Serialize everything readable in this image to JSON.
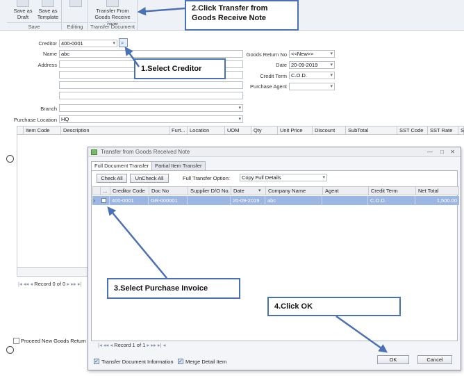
{
  "ribbon": {
    "save_as_draft": "Save as Draft",
    "save_as_template": "Save as Template",
    "group_save": "Save",
    "group_editing": "Editing",
    "transfer_from_grn": "Transfer From Goods Receive Note",
    "group_transfer": "Transfer Document"
  },
  "form": {
    "creditor_label": "Creditor",
    "creditor_value": "400-0001",
    "name_label": "Name",
    "name_value": "abc",
    "address_label": "Address",
    "branch_label": "Branch",
    "purchase_location_label": "Purchase Location",
    "purchase_location_value": "HQ",
    "goods_return_no_label": "Goods Return No",
    "goods_return_no_value": "<<New>>",
    "date_label": "Date",
    "date_value": "20-09-2019",
    "credit_term_label": "Credit Term",
    "credit_term_value": "C.O.D.",
    "purchase_agent_label": "Purchase Agent"
  },
  "grid": {
    "columns": [
      "Item Code",
      "Description",
      "Furt...",
      "Location",
      "UOM",
      "Qty",
      "Unit Price",
      "Discount",
      "SubTotal",
      "SST Code",
      "SST Rate",
      "Sa"
    ],
    "record_label": "Record 0 of 0",
    "proceed_label": "Proceed New Goods Return"
  },
  "dialog": {
    "title": "Transfer from Goods Received Note",
    "tab_full": "Full Document Transfer",
    "tab_partial": "Partial Item Transfer",
    "check_all": "Check All",
    "uncheck_all": "UnCheck All",
    "full_transfer_option_label": "Full Transfer Option:",
    "full_transfer_option_value": "Copy Full Details",
    "columns": [
      "...",
      "Creditor Code",
      "Doc No",
      "Supplier D/O No.",
      "Date",
      "Company Name",
      "Agent",
      "Credit Term",
      "Net Total"
    ],
    "row": {
      "creditor_code": "400-0001",
      "doc_no": "GR-000001",
      "supplier_do": "",
      "date": "20-09-2019",
      "company_name": "abc",
      "agent": "",
      "credit_term": "C.O.D.",
      "net_total": "1,500.00"
    },
    "record_label": "Record 1 of 1",
    "transfer_doc_info": "Transfer Document Information",
    "merge_detail_item": "Merge Detail Item",
    "ok": "OK",
    "cancel": "Cancel"
  },
  "callouts": {
    "step1": "1.Select Creditor",
    "step2_line1": "2.Click Transfer from",
    "step2_line2": "Goods Receive Note",
    "step3": "3.Select Purchase Invoice",
    "step4": "4.Click OK"
  },
  "colors": {
    "callout_border": "#4a70b5",
    "selected_row": "#9db7e4",
    "ribbon_bg": "#eef1f6"
  }
}
